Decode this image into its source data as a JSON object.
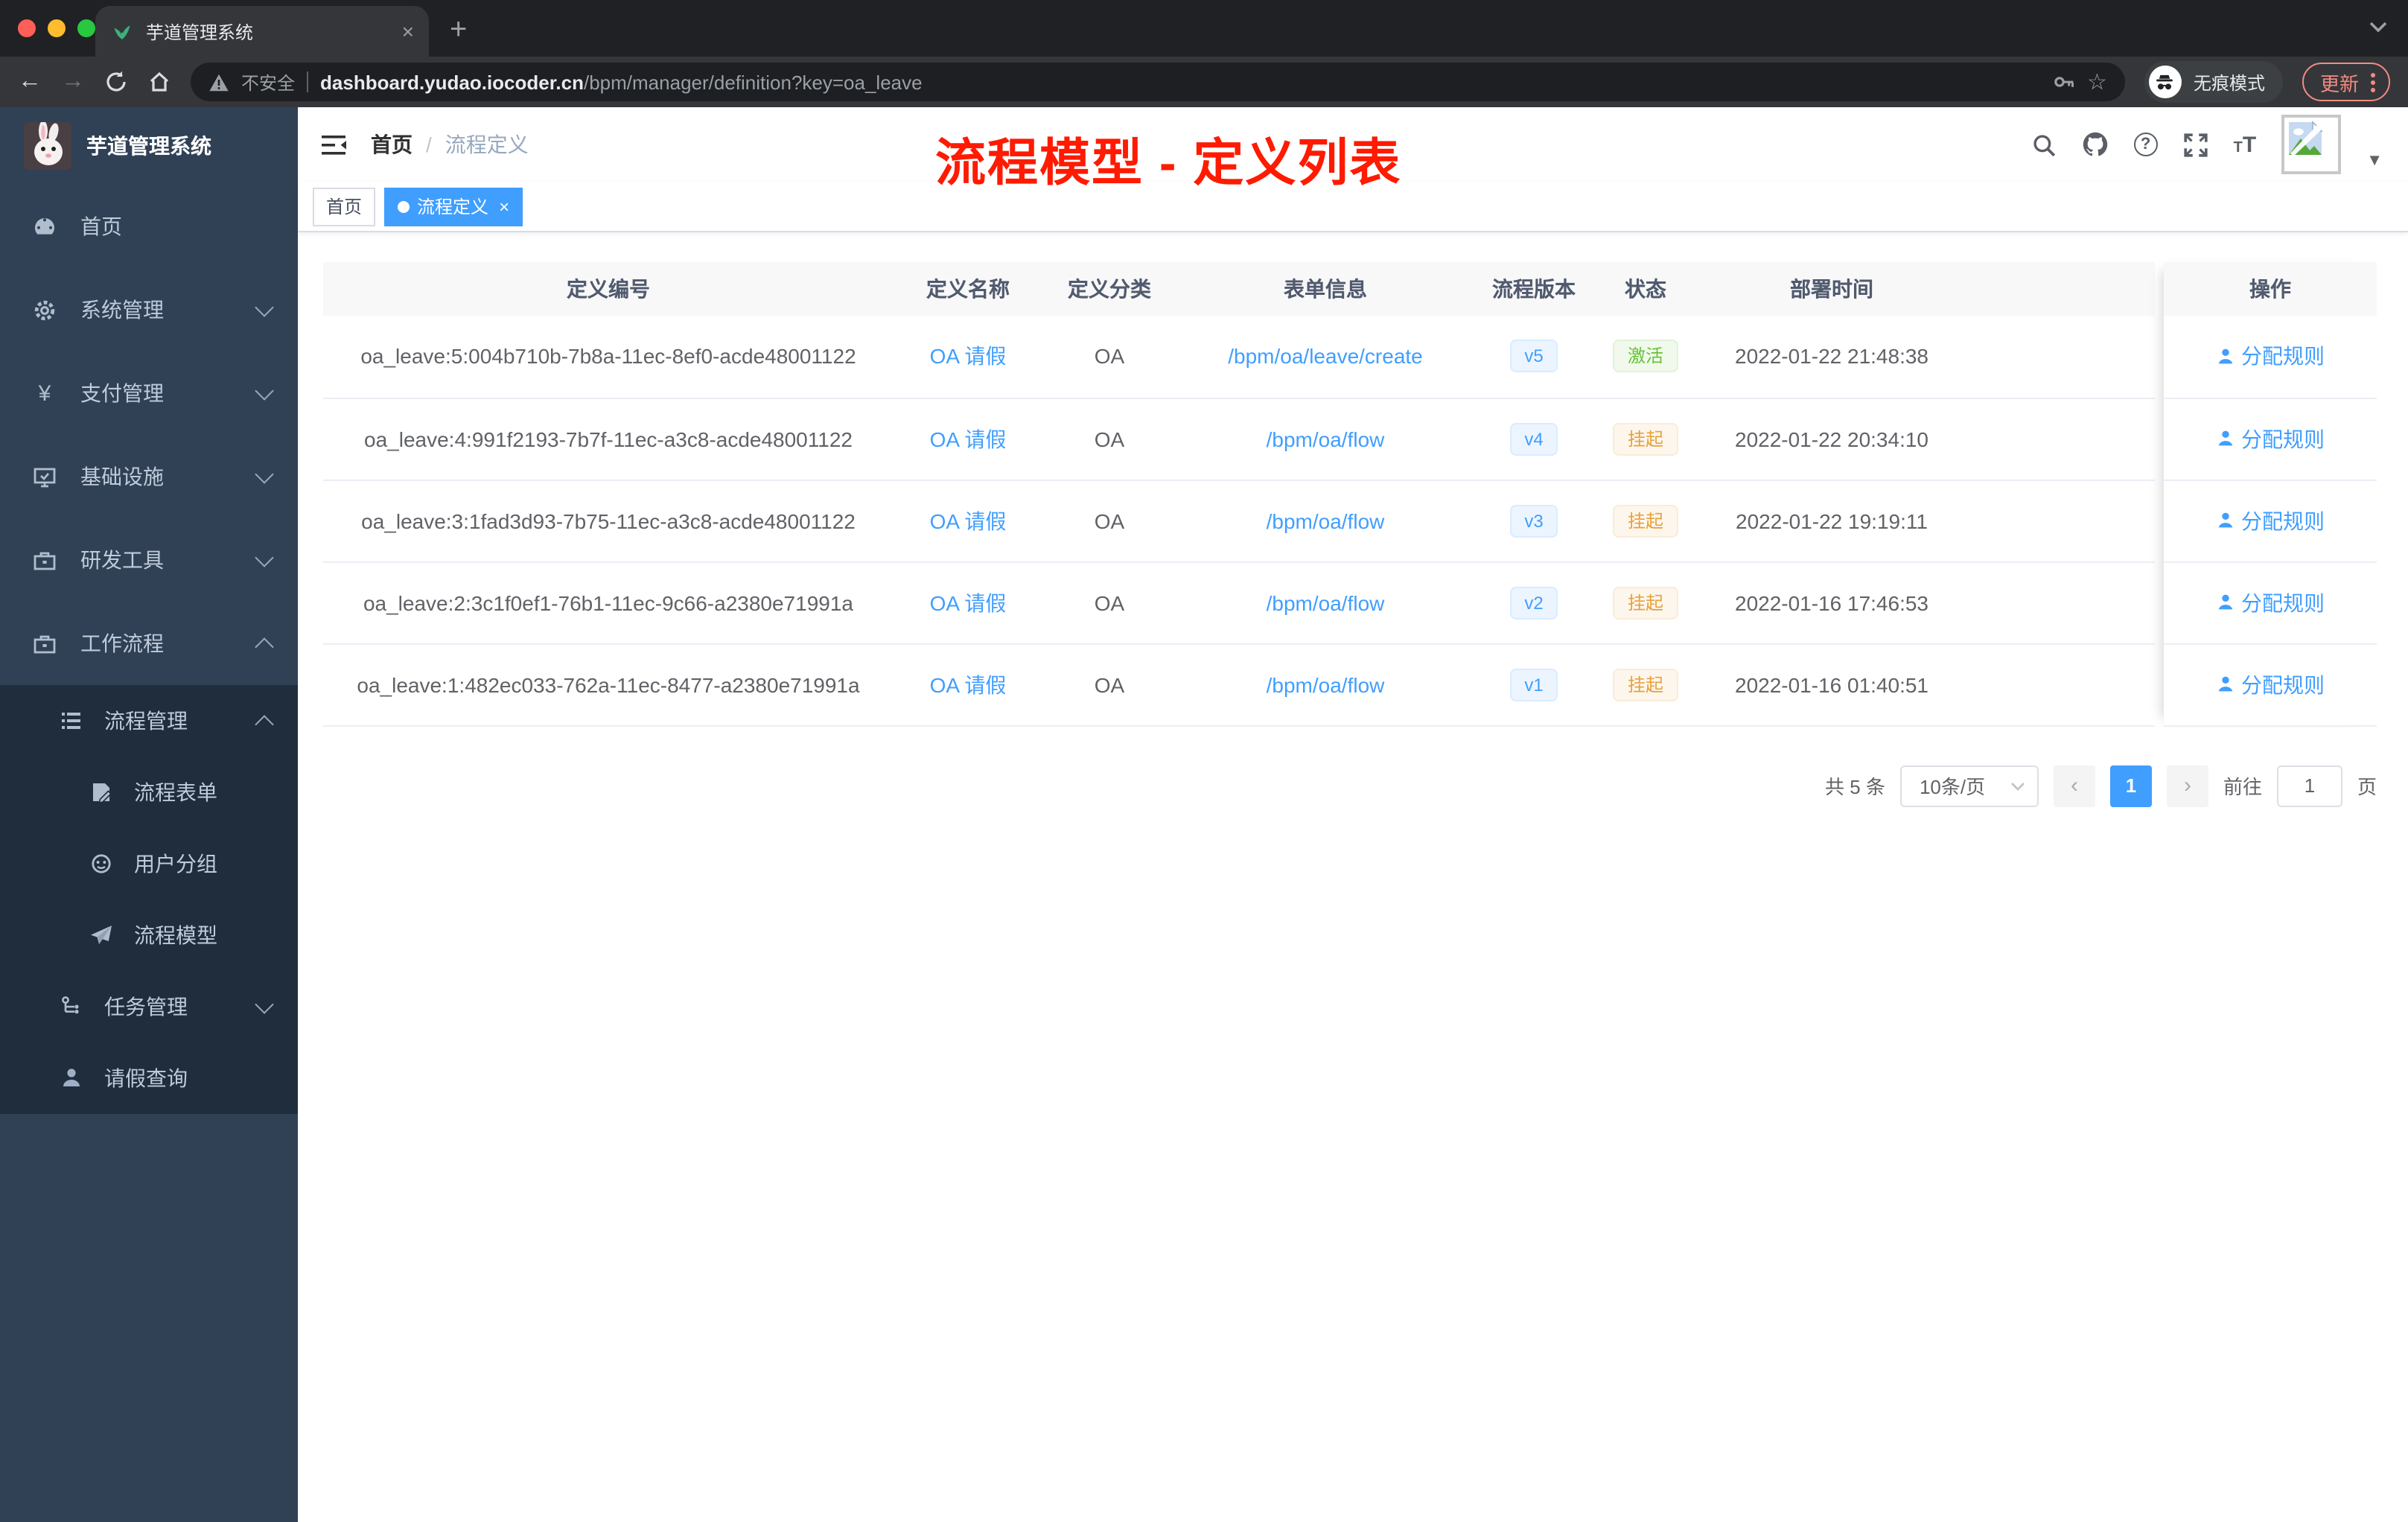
{
  "colors": {
    "accent": "#409eff",
    "success": "#67c23a",
    "warning": "#e6a23c",
    "sidebar_bg": "#304156",
    "submenu_bg": "#1f2d3d",
    "sidebar_text": "#bfcbd9",
    "annotation": "#ff1a00",
    "chrome_bg": "#202124",
    "toolbar_bg": "#35363a",
    "update_btn": "#f28b82"
  },
  "browser": {
    "tab_title": "芋道管理系统",
    "close_glyph": "×",
    "new_tab_glyph": "+",
    "back_glyph": "←",
    "forward_glyph": "→",
    "security_label": "不安全",
    "url_host": "dashboard.yudao.iocoder.cn",
    "url_path": "/bpm/manager/definition?key=oa_leave",
    "star_glyph": "☆",
    "incognito_label": "无痕模式",
    "update_label": "更新"
  },
  "sidebar": {
    "title": "芋道管理系统",
    "items": [
      {
        "label": "首页",
        "icon": "dashboard-icon"
      },
      {
        "label": "系统管理",
        "icon": "gear-icon",
        "chevron": "down"
      },
      {
        "label": "支付管理",
        "icon": "yen-icon",
        "chevron": "down",
        "icon_glyph": "¥"
      },
      {
        "label": "基础设施",
        "icon": "monitor-icon",
        "chevron": "down"
      },
      {
        "label": "研发工具",
        "icon": "toolbox-icon",
        "chevron": "down"
      },
      {
        "label": "工作流程",
        "icon": "briefcase-icon",
        "chevron": "up"
      }
    ],
    "submenu": [
      {
        "label": "流程管理",
        "icon": "tree-list-icon",
        "chevron": "up"
      },
      {
        "label": "流程表单",
        "icon": "form-icon"
      },
      {
        "label": "用户分组",
        "icon": "people-icon"
      },
      {
        "label": "流程模型",
        "icon": "paper-plane-icon"
      },
      {
        "label": "任务管理",
        "icon": "flow-icon",
        "chevron": "down"
      },
      {
        "label": "请假查询",
        "icon": "person-icon"
      }
    ]
  },
  "header": {
    "breadcrumb": [
      "首页",
      "流程定义"
    ],
    "breadcrumb_sep": "/",
    "annotation": "流程模型 - 定义列表",
    "help_glyph": "?",
    "caret_glyph": "▼"
  },
  "tags": [
    {
      "label": "首页",
      "active": false
    },
    {
      "label": "流程定义",
      "active": true,
      "close_glyph": "×"
    }
  ],
  "table": {
    "columns": [
      "定义编号",
      "定义名称",
      "定义分类",
      "表单信息",
      "流程版本",
      "状态",
      "部署时间",
      "操作"
    ],
    "rows": [
      {
        "id": "oa_leave:5:004b710b-7b8a-11ec-8ef0-acde48001122",
        "name": "OA 请假",
        "category": "OA",
        "form": "/bpm/oa/leave/create",
        "version": "v5",
        "status": "激活",
        "status_type": "success",
        "time": "2022-01-22 21:48:38",
        "action": "分配规则"
      },
      {
        "id": "oa_leave:4:991f2193-7b7f-11ec-a3c8-acde48001122",
        "name": "OA 请假",
        "category": "OA",
        "form": "/bpm/oa/flow",
        "version": "v4",
        "status": "挂起",
        "status_type": "warning",
        "time": "2022-01-22 20:34:10",
        "action": "分配规则"
      },
      {
        "id": "oa_leave:3:1fad3d93-7b75-11ec-a3c8-acde48001122",
        "name": "OA 请假",
        "category": "OA",
        "form": "/bpm/oa/flow",
        "version": "v3",
        "status": "挂起",
        "status_type": "warning",
        "time": "2022-01-22 19:19:11",
        "action": "分配规则"
      },
      {
        "id": "oa_leave:2:3c1f0ef1-76b1-11ec-9c66-a2380e71991a",
        "name": "OA 请假",
        "category": "OA",
        "form": "/bpm/oa/flow",
        "version": "v2",
        "status": "挂起",
        "status_type": "warning",
        "time": "2022-01-16 17:46:53",
        "action": "分配规则"
      },
      {
        "id": "oa_leave:1:482ec033-762a-11ec-8477-a2380e71991a",
        "name": "OA 请假",
        "category": "OA",
        "form": "/bpm/oa/flow",
        "version": "v1",
        "status": "挂起",
        "status_type": "warning",
        "time": "2022-01-16 01:40:51",
        "action": "分配规则"
      }
    ]
  },
  "pagination": {
    "total": "共 5 条",
    "page_size": "10条/页",
    "prev_glyph": "‹",
    "next_glyph": "›",
    "current_page": "1",
    "goto_label": "前往",
    "goto_value": "1",
    "page_unit": "页"
  }
}
